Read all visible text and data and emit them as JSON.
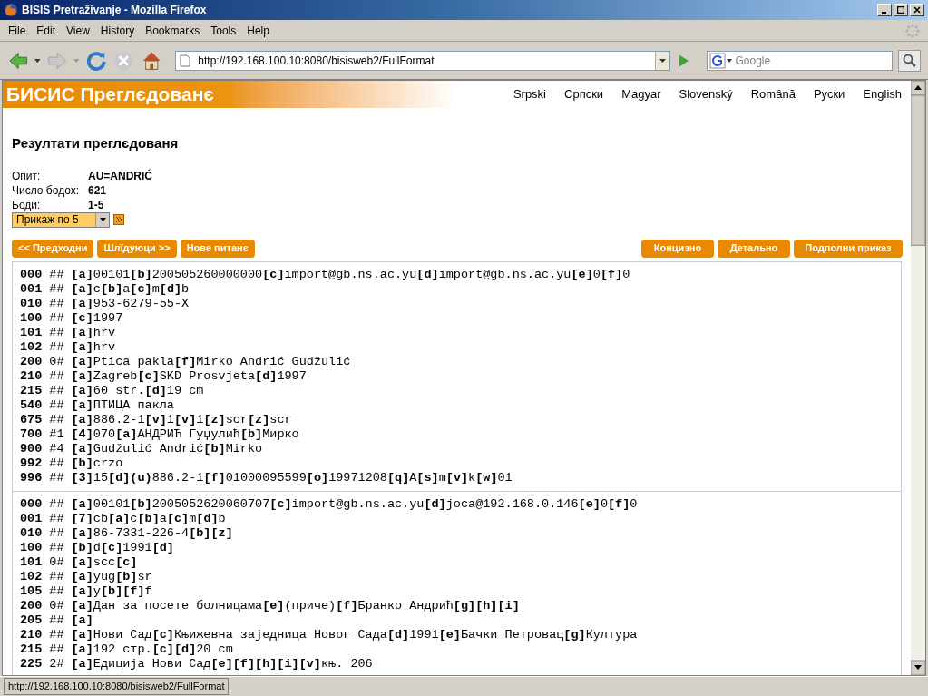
{
  "window": {
    "title": "BISIS Pretraživanje - Mozilla Firefox"
  },
  "menu": [
    "File",
    "Edit",
    "View",
    "History",
    "Bookmarks",
    "Tools",
    "Help"
  ],
  "address": {
    "value": "http://192.168.100.10:8080/bisisweb2/FullFormat"
  },
  "search": {
    "placeholder": "Google"
  },
  "banner": {
    "title": "БИСИС Преглєдованє"
  },
  "languages": [
    "Srpski",
    "Српски",
    "Magyar",
    "Slovenský",
    "Română",
    "Руски",
    "English"
  ],
  "heading": "Резултати преглєдованя",
  "query": [
    {
      "label": "Опит:",
      "value": "AU=ANDRIĆ"
    },
    {
      "label": "Число бодох:",
      "value": "621"
    },
    {
      "label": "Боди:",
      "value": "1-5"
    }
  ],
  "page_size_select": {
    "value": "Прикаж по 5"
  },
  "nav_buttons": [
    "<< Предходни",
    "Шлїдуюци >>",
    "Нове питанє"
  ],
  "format_buttons": [
    "Концизно",
    "Детально",
    "Подполни приказ"
  ],
  "records": [
    [
      {
        "tag": "000",
        "ind": "##",
        "content": "**[a]**00101**[b]**200505260000000**[c]**import@gb.ns.ac.yu**[d]**import@gb.ns.ac.yu**[e]**0**[f]**0"
      },
      {
        "tag": "001",
        "ind": "##",
        "content": "**[a]**c**[b]**a**[c]**m**[d]**b"
      },
      {
        "tag": "010",
        "ind": "##",
        "content": "**[a]**953-6279-55-X"
      },
      {
        "tag": "100",
        "ind": "##",
        "content": "**[c]**1997"
      },
      {
        "tag": "101",
        "ind": "##",
        "content": "**[a]**hrv"
      },
      {
        "tag": "102",
        "ind": "##",
        "content": "**[a]**hrv"
      },
      {
        "tag": "200",
        "ind": "0#",
        "content": "**[a]**Ptica pakla**[f]**Mirko Andrić Gudžulić"
      },
      {
        "tag": "210",
        "ind": "##",
        "content": "**[a]**Zagreb**[c]**SKD Prosvjeta**[d]**1997"
      },
      {
        "tag": "215",
        "ind": "##",
        "content": "**[a]**60 str.**[d]**19 cm"
      },
      {
        "tag": "540",
        "ind": "##",
        "content": "**[a]**ПТИЦА пакла"
      },
      {
        "tag": "675",
        "ind": "##",
        "content": "**[a]**886.2-1**[v]**1**[v]**1**[z]**scr**[z]**scr"
      },
      {
        "tag": "700",
        "ind": "#1",
        "content": "**[4]**070**[a]**АНДРИЋ Гуџулић**[b]**Мирко"
      },
      {
        "tag": "900",
        "ind": "#4",
        "content": "**[a]**Gudžulić Andrić**[b]**Mirko"
      },
      {
        "tag": "992",
        "ind": "##",
        "content": "**[b]**crzo"
      },
      {
        "tag": "996",
        "ind": "##",
        "content": "**[3]**15**[d]****(u)**886.2-1**[f]**01000095599**[o]**19971208**[q]**A**[s]**m**[v]**k**[w]**01"
      }
    ],
    [
      {
        "tag": "000",
        "ind": "##",
        "content": "**[a]**00101**[b]**2005052620060707**[c]**import@gb.ns.ac.yu**[d]**joca@192.168.0.146**[e]**0**[f]**0"
      },
      {
        "tag": "001",
        "ind": "##",
        "content": "**[7]**cb**[a]**c**[b]**a**[c]**m**[d]**b"
      },
      {
        "tag": "010",
        "ind": "##",
        "content": "**[a]**86-7331-226-4**[b][z]**"
      },
      {
        "tag": "100",
        "ind": "##",
        "content": "**[b]**d**[c]**1991**[d]**"
      },
      {
        "tag": "101",
        "ind": "0#",
        "content": "**[a]**scc**[c]**"
      },
      {
        "tag": "102",
        "ind": "##",
        "content": "**[a]**yug**[b]**sr"
      },
      {
        "tag": "105",
        "ind": "##",
        "content": "**[a]**y**[b][f]**f"
      },
      {
        "tag": "200",
        "ind": "0#",
        "content": "**[a]**Дан за посете болницама**[e]**(приче)**[f]**Бранко Андрић**[g][h][i]**"
      },
      {
        "tag": "205",
        "ind": "##",
        "content": "**[a]**"
      },
      {
        "tag": "210",
        "ind": "##",
        "content": "**[a]**Нови Сад**[c]**Књижевна заједница Новог Сада**[d]**1991**[e]**Бачки Петровац**[g]**Култура"
      },
      {
        "tag": "215",
        "ind": "##",
        "content": "**[a]**192 стр.**[c][d]**20 cm"
      },
      {
        "tag": "225",
        "ind": "2#",
        "content": "**[a]**Едиција Нови Сад**[e][f][h][i][v]**књ. 206"
      }
    ]
  ],
  "status_bar": "http://192.168.100.10:8080/bisisweb2/FullFormat"
}
